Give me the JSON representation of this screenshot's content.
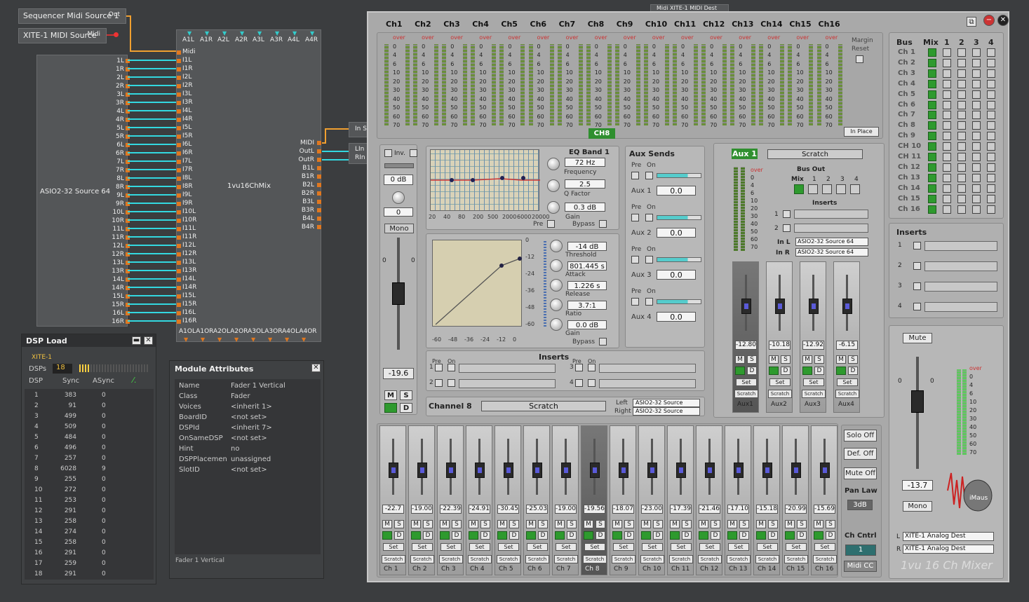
{
  "sources": {
    "seq": "Sequencer Midi Source 1",
    "seq_out": "Out",
    "xite": "XITE-1 MIDI Source",
    "xite_out": "Midi",
    "asio": "ASIO2-32 Source 64",
    "mix": "1vu16ChMix"
  },
  "asio_pins": [
    "1L",
    "1R",
    "2L",
    "2R",
    "3L",
    "3R",
    "4L",
    "4R",
    "5L",
    "5R",
    "6L",
    "6R",
    "7L",
    "7R",
    "8L",
    "8R",
    "9L",
    "9R",
    "10L",
    "10R",
    "11L",
    "11R",
    "12L",
    "12R",
    "13L",
    "13R",
    "14L",
    "14R",
    "15L",
    "15R",
    "16L",
    "16R"
  ],
  "mix_in": [
    "Midi",
    "I1L",
    "I1R",
    "I2L",
    "I2R",
    "I3L",
    "I3R",
    "I4L",
    "I4R",
    "I5L",
    "I5R",
    "I6L",
    "I6R",
    "I7L",
    "I7R",
    "I8L",
    "I8R",
    "I9L",
    "I9R",
    "I10L",
    "I10R",
    "I11L",
    "I11R",
    "I12L",
    "I12R",
    "I13L",
    "I13R",
    "I14L",
    "I14R",
    "I15L",
    "I15R",
    "I16L",
    "I16R"
  ],
  "mix_top": [
    "A1L",
    "A1R",
    "A2L",
    "A2R",
    "A3L",
    "A3R",
    "A4L",
    "A4R"
  ],
  "mix_bottom": "A1OLA1ORA2OLA2ORA3OLA3ORA4OLA4OR",
  "mix_out": [
    "MIDI",
    "OutL",
    "OutR",
    "B1L",
    "B1R",
    "B2L",
    "B2R",
    "B3L",
    "B3R",
    "B4L",
    "B4R"
  ],
  "dest": {
    "ins": "In S",
    "lin": "LIn",
    "rin": "RIn",
    "top": "Midi XITE-1 MIDI Dest"
  },
  "dsp": {
    "title": "DSP Load",
    "device": "XITE-1",
    "dsps_label": "DSPs",
    "dsps": "18",
    "cols": [
      "DSP",
      "Sync",
      "ASync"
    ],
    "rows": [
      [
        "1",
        "383",
        "0"
      ],
      [
        "2",
        "91",
        "0"
      ],
      [
        "3",
        "499",
        "0"
      ],
      [
        "4",
        "509",
        "0"
      ],
      [
        "5",
        "484",
        "0"
      ],
      [
        "6",
        "496",
        "0"
      ],
      [
        "7",
        "257",
        "0"
      ],
      [
        "8",
        "6028",
        "9"
      ],
      [
        "9",
        "255",
        "0"
      ],
      [
        "10",
        "272",
        "0"
      ],
      [
        "11",
        "253",
        "0"
      ],
      [
        "12",
        "291",
        "0"
      ],
      [
        "13",
        "258",
        "0"
      ],
      [
        "14",
        "274",
        "0"
      ],
      [
        "15",
        "258",
        "0"
      ],
      [
        "16",
        "291",
        "0"
      ],
      [
        "17",
        "259",
        "0"
      ],
      [
        "18",
        "291",
        "0"
      ]
    ]
  },
  "attrs": {
    "title": "Module Attributes",
    "rows": [
      [
        "Name",
        "Fader 1 Vertical"
      ],
      [
        "Class",
        "Fader"
      ],
      [
        "Voices",
        "<inherit 1>"
      ],
      [
        "BoardID",
        "<not set>"
      ],
      [
        "DSPId",
        "<inherit 7>"
      ],
      [
        "OnSameDSP",
        "<not set>"
      ],
      [
        "Hint",
        "no"
      ],
      [
        "DSPPlacemen",
        "unassigned"
      ],
      [
        "SlotID",
        "<not set>"
      ]
    ],
    "footer": "Fader 1 Vertical"
  },
  "mixer": {
    "channels": [
      "Ch1",
      "Ch2",
      "Ch3",
      "Ch4",
      "Ch5",
      "Ch6",
      "Ch7",
      "Ch8",
      "Ch9",
      "Ch10",
      "Ch11",
      "Ch12",
      "Ch13",
      "Ch14",
      "Ch15",
      "Ch16"
    ],
    "meter_scale": [
      "over",
      "0",
      "4",
      "6",
      "10",
      "20",
      "30",
      "40",
      "50",
      "60",
      "70"
    ],
    "margin": "Margin",
    "reset": "Reset",
    "inplace": "In Place",
    "selected": "CH8",
    "bus": {
      "bus": "Bus",
      "mix": "Mix",
      "cols": [
        "1",
        "2",
        "3",
        "4"
      ],
      "rows": [
        "Ch 1",
        "Ch 2",
        "Ch 3",
        "Ch 4",
        "Ch 5",
        "Ch 6",
        "Ch 7",
        "Ch 8",
        "Ch 9",
        "CH 10",
        "CH 11",
        "Ch 12",
        "Ch 13",
        "Ch 14",
        "Ch 15",
        "Ch 16"
      ]
    },
    "strip": {
      "inv": "Inv.",
      "gain": "0 dB",
      "pan": "0",
      "mono": "Mono",
      "fader": "-19.6",
      "m": "M",
      "s": "S",
      "d": "D"
    },
    "eq": {
      "title": "EQ Band 1",
      "freq": "72 Hz",
      "freq_l": "Frequency",
      "q": "2.5",
      "q_l": "Q Factor",
      "gain": "0.3 dB",
      "gain_l": "Gain",
      "pre": "Pre",
      "bypass": "Bypass",
      "axis": [
        "20",
        "40",
        "80",
        "200",
        "500",
        "2000",
        "6000",
        "20000"
      ]
    },
    "comp": {
      "thr": "-14 dB",
      "thr_l": "Threshold",
      "att": "801.445 s",
      "att_l": "Attack",
      "rel": "1.226 s",
      "rel_l": "Release",
      "ratio": "3.7:1",
      "ratio_l": "Ratio",
      "gain": "0.0 dB",
      "gain_l": "Gain",
      "bypass": "Bypass",
      "y": [
        "0",
        "-12",
        "-24",
        "-36",
        "-48",
        "-60"
      ],
      "x": [
        "-60",
        "-48",
        "-36",
        "-24",
        "-12",
        "0"
      ]
    },
    "aux": {
      "title": "Aux Sends",
      "pre": "Pre",
      "on": "On",
      "items": [
        [
          "Aux 1",
          "0.0"
        ],
        [
          "Aux 2",
          "0.0"
        ],
        [
          "Aux 3",
          "0.0"
        ],
        [
          "Aux 4",
          "0.0"
        ]
      ]
    },
    "inserts": {
      "title": "Inserts",
      "pre": "Pre",
      "on": "On",
      "slots": [
        "1",
        "2",
        "3",
        "4"
      ]
    },
    "chname": {
      "label": "Channel 8",
      "name": "Scratch",
      "left": "Left",
      "right": "Right",
      "ldest": "ASIO2-32 Source",
      "rdest": "ASIO2-32 Source"
    },
    "auxpanel": {
      "tag": "Aux 1",
      "name": "Scratch",
      "busout": "Bus Out",
      "mix": "Mix",
      "cols": [
        "1",
        "2",
        "3",
        "4"
      ],
      "inserts": "Inserts",
      "inl": "In L",
      "inr": "In R",
      "inl_v": "ASIO2-32 Source 64",
      "inr_v": "ASIO2-32 Source 64",
      "faders": [
        [
          "-12.80",
          "Aux1"
        ],
        [
          "-10.18",
          "Aux2"
        ],
        [
          "-12.92",
          "Aux3"
        ],
        [
          "-6.15",
          "Aux4"
        ]
      ],
      "set": "Set",
      "scratch": "Scratch"
    },
    "bottom_vals": [
      "-22.7",
      "-19.00",
      "-22.39",
      "-24.91",
      "-30.45",
      "-25.03",
      "-19.00",
      "-19.56",
      "-18.07",
      "-23.00",
      "-17.39",
      "-21.46",
      "-17.10",
      "-15.18",
      "-20.99",
      "-15.69"
    ],
    "bottom_labels": [
      "Ch 1",
      "Ch 2",
      "Ch 3",
      "Ch 4",
      "Ch 5",
      "Ch 6",
      "Ch 7",
      "Ch 8",
      "Ch 9",
      "Ch 10",
      "Ch 11",
      "Ch 12",
      "Ch 13",
      "Ch 14",
      "Ch 15",
      "Ch 16"
    ],
    "side": {
      "solo": "Solo Off",
      "def": "Def. Off",
      "mute": "Mute Off",
      "panlaw": "Pan Law",
      "db": "3dB",
      "chcntrl": "Ch Cntrl",
      "chval": "1",
      "midicc": "Midi CC"
    },
    "master": {
      "inserts": "Inserts",
      "slots": [
        "1",
        "2",
        "3",
        "4"
      ],
      "mute": "Mute",
      "val": "-13.7",
      "mono": "Mono",
      "l": "L",
      "r": "R",
      "ldest": "XITE-1 Analog Dest",
      "rdest": "XITE-1 Analog Dest",
      "brand": "iMaus",
      "name": "1vu 16 Ch Mixer",
      "zero": "0"
    }
  }
}
